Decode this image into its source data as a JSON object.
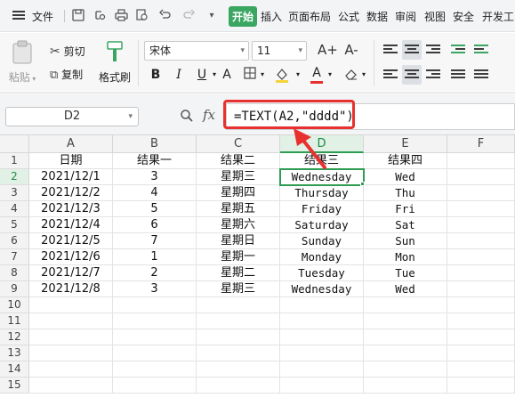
{
  "menu": {
    "file_label": "文件",
    "tabs": [
      "开始",
      "插入",
      "页面布局",
      "公式",
      "数据",
      "审阅",
      "视图",
      "安全",
      "开发工"
    ]
  },
  "ribbon": {
    "paste_label": "粘贴",
    "cut_label": "剪切",
    "copy_label": "复制",
    "format_painter_label": "格式刷",
    "font_name": "宋体",
    "font_size": "11",
    "bold": "B",
    "italic": "I",
    "underline": "U",
    "increase_font": "A+",
    "decrease_font": "A-",
    "font_color_letter": "A",
    "accent_color": "#3aa661",
    "underline_bar_color": "#e8312f",
    "highlight_bar_color": "#f5d33b"
  },
  "formula_bar": {
    "name_box": "D2",
    "fx_label": "fx",
    "formula": "=TEXT(A2,\"dddd\")"
  },
  "grid": {
    "columns": [
      "A",
      "B",
      "C",
      "D",
      "E",
      "F"
    ],
    "selected_column": "D",
    "selected_row": "2",
    "row_numbers": [
      "1",
      "2",
      "3",
      "4",
      "5",
      "6",
      "7",
      "8",
      "9",
      "10",
      "11",
      "12",
      "13",
      "14",
      "15"
    ],
    "rows": [
      [
        "日期",
        "结果一",
        "结果二",
        "结果三",
        "结果四"
      ],
      [
        "2021/12/1",
        "3",
        "星期三",
        "Wednesday",
        "Wed"
      ],
      [
        "2021/12/2",
        "4",
        "星期四",
        "Thursday",
        "Thu"
      ],
      [
        "2021/12/3",
        "5",
        "星期五",
        "Friday",
        "Fri"
      ],
      [
        "2021/12/4",
        "6",
        "星期六",
        "Saturday",
        "Sat"
      ],
      [
        "2021/12/5",
        "7",
        "星期日",
        "Sunday",
        "Sun"
      ],
      [
        "2021/12/6",
        "1",
        "星期一",
        "Monday",
        "Mon"
      ],
      [
        "2021/12/7",
        "2",
        "星期二",
        "Tuesday",
        "Tue"
      ],
      [
        "2021/12/8",
        "3",
        "星期三",
        "Wednesday",
        "Wed"
      ]
    ],
    "selection_color": "#2e9d52"
  },
  "annotation": {
    "color": "#e8312f"
  }
}
